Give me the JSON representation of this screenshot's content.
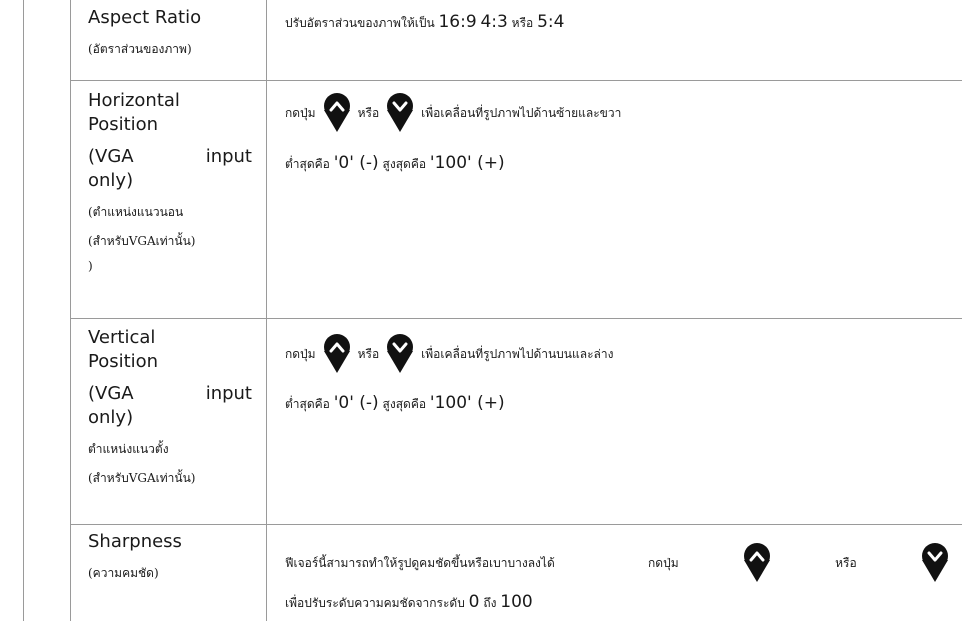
{
  "rows": [
    {
      "en_lines": [
        "Aspect Ratio"
      ],
      "th_lines": [
        "(อัตราส่วนของภาพ)"
      ],
      "desc": {
        "text": "ปรับอัตราส่วนของภาพให้เป็น ",
        "opt1": "16:9",
        "opt2": "4:3",
        "or": "หรือ",
        "opt3": "5:4"
      }
    },
    {
      "en_lines": [
        "Horizontal",
        "Position"
      ],
      "en_just": [
        "(VGA",
        "input"
      ],
      "en_tail": "only)",
      "th_lines": [
        "(ตำแหน่งแนวนอน",
        "(สำหรับVGAเท่านั้น)",
        ")"
      ],
      "desc": {
        "press": "กดปุ่ม",
        "or": "หรือ",
        "action": "เพื่อเคลื่อนที่รูปภาพไปด้านซ้ายและขวา",
        "min_label": "ต่ำสุดคือ",
        "min_value": "'0' (-)",
        "max_label": "สูงสุดคือ",
        "max_value": "'100' (+)"
      }
    },
    {
      "en_lines": [
        "Vertical",
        "Position"
      ],
      "en_just": [
        "(VGA",
        "input"
      ],
      "en_tail": "only)",
      "th_lines": [
        "ตำแหน่งแนวตั้ง",
        "(สำหรับVGAเท่านั้น)"
      ],
      "desc": {
        "press": "กดปุ่ม",
        "or": "หรือ",
        "action": "เพื่อเคลื่อนที่รูปภาพไปด้านบนและล่าง",
        "min_label": "ต่ำสุดคือ",
        "min_value": "'0' (-)",
        "max_label": "สูงสุดคือ",
        "max_value": "'100' (+)"
      }
    },
    {
      "en_lines": [
        "Sharpness"
      ],
      "th_lines": [
        "(ความคมชัด)"
      ],
      "desc": {
        "text": "ฟีเจอร์นี้สามารถทำให้รูปดูคมชัดขึ้นหรือเบาบางลงได้",
        "press": "กดปุ่ม",
        "or": "หรือ",
        "line2": "เพื่อปรับระดับความคมชัดจากระดับ",
        "min": "0",
        "to": "ถึง",
        "max": "100"
      }
    }
  ],
  "icons": {
    "up": "up-arrow-button-icon",
    "down": "down-arrow-button-icon"
  }
}
